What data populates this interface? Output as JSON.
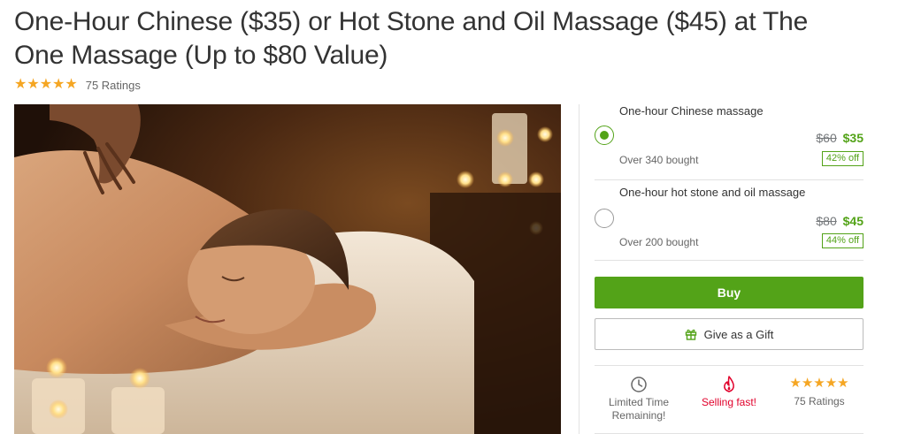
{
  "deal": {
    "title": "One-Hour Chinese ($35) or Hot Stone and Oil Massage ($45) at The One Massage (Up to $80 Value)",
    "rating_count": "75 Ratings",
    "rating_value": 5,
    "rating_max": 5
  },
  "options": [
    {
      "title": "One-hour Chinese massage",
      "selected": true,
      "old_price": "$60",
      "new_price": "$35",
      "bought": "Over 340 bought",
      "discount": "42% off"
    },
    {
      "title": "One-hour hot stone and oil massage",
      "selected": false,
      "old_price": "$80",
      "new_price": "$45",
      "bought": "Over 200 bought",
      "discount": "44% off"
    }
  ],
  "actions": {
    "buy_label": "Buy",
    "gift_label": "Give as a Gift"
  },
  "badges": {
    "limited_line1": "Limited Time",
    "limited_line2": "Remaining!",
    "selling": "Selling fast!",
    "ratings": "75 Ratings"
  },
  "colors": {
    "accent_green": "#53a318",
    "star_gold": "#f5a623",
    "hot_red": "#e1002b"
  },
  "icons": [
    "star-icon",
    "clock-icon",
    "flame-icon",
    "gift-icon"
  ]
}
